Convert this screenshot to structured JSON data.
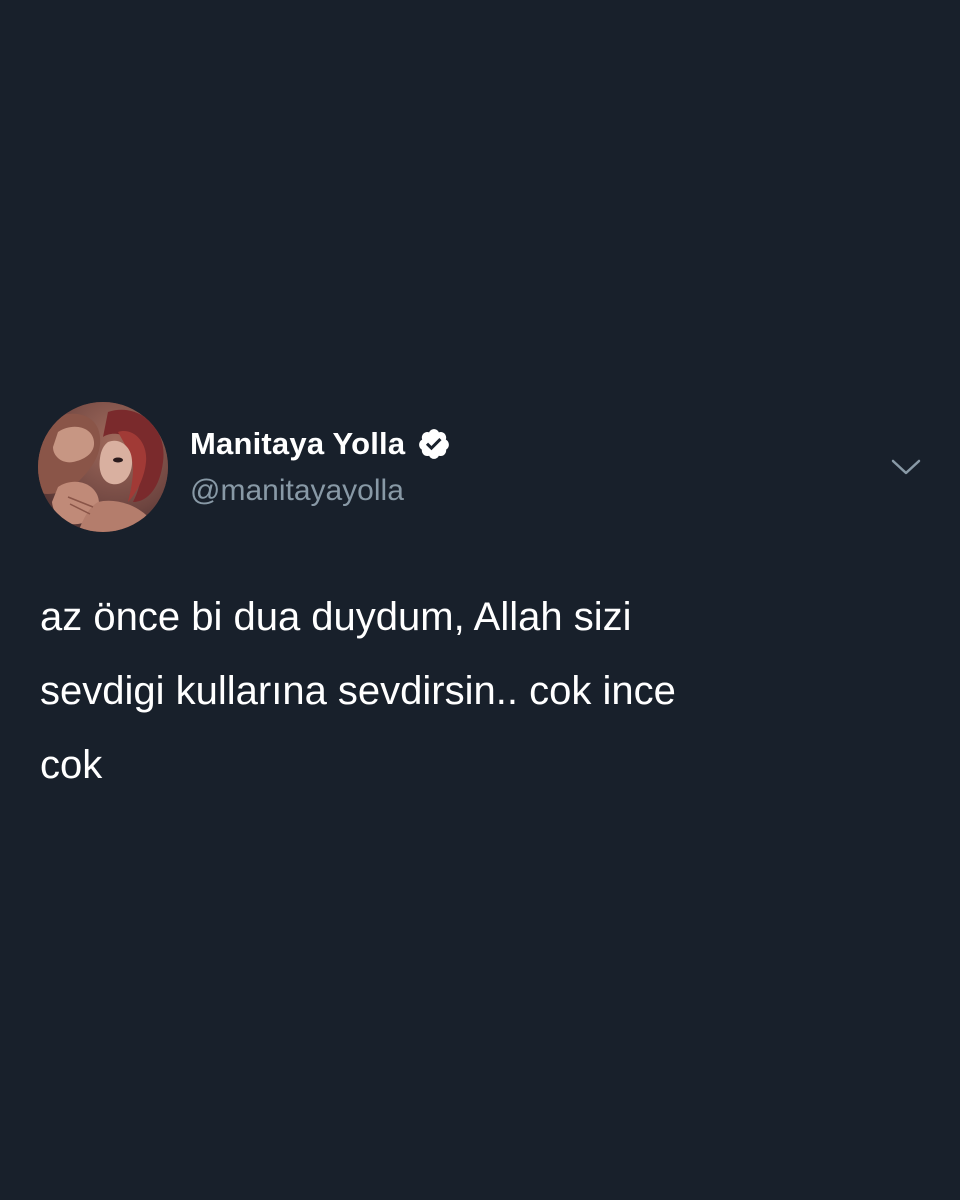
{
  "tweet": {
    "author": {
      "display_name": "Manitaya Yolla",
      "handle": "@manitayayolla",
      "verified": true,
      "avatar_icon": "illustrated-couple-avatar"
    },
    "menu_icon": "chevron-down-icon",
    "text_lines": [
      "az önce bi dua duydum, Allah sizi",
      "sevdigi kullarına sevdirsin.. cok ince",
      "cok"
    ]
  },
  "colors": {
    "background": "#18202b",
    "text": "#ffffff",
    "handle": "#8899a6",
    "icon": "#8899a6"
  }
}
